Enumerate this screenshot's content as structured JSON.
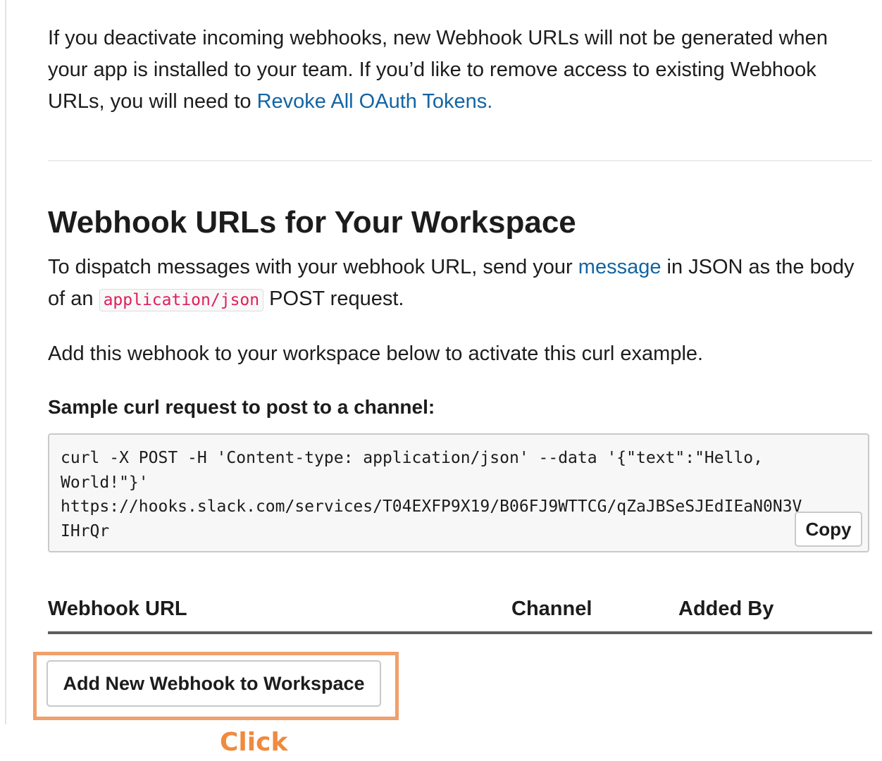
{
  "intro": {
    "text": "If you deactivate incoming webhooks, new Webhook URLs will not be generated when your app is installed to your team. If you’d like to remove access to existing Webhook URLs, you will need to ",
    "link": "Revoke All OAuth Tokens."
  },
  "section": {
    "title": "Webhook URLs for Your Workspace",
    "dispatch_before": "To dispatch messages with your webhook URL, send your ",
    "dispatch_link": "message",
    "dispatch_middle": " in JSON as the body of an ",
    "dispatch_code": "application/json",
    "dispatch_after": " POST request.",
    "activate_text": "Add this webhook to your workspace below to activate this curl example.",
    "sample_heading": "Sample curl request to post to a channel:",
    "code_lines": [
      "curl -X POST -H 'Content-type: application/json' --data '{\"text\":\"Hello,",
      "World!\"}'",
      "https://hooks.slack.com/services/T04EXFP9X19/B06FJ9WTTCG/qZaJBSeSJEdIEaN0N3V",
      "IHrQr"
    ],
    "copy_label": "Copy"
  },
  "table": {
    "headers": [
      "Webhook URL",
      "Channel",
      "Added By"
    ]
  },
  "add_button_label": "Add New Webhook to Workspace",
  "annotation": {
    "label": "Click",
    "color": "#f08a3e",
    "box_color": "#f0a06c"
  },
  "colors": {
    "link": "#1264a3",
    "inline_code": "#e01e5a"
  }
}
